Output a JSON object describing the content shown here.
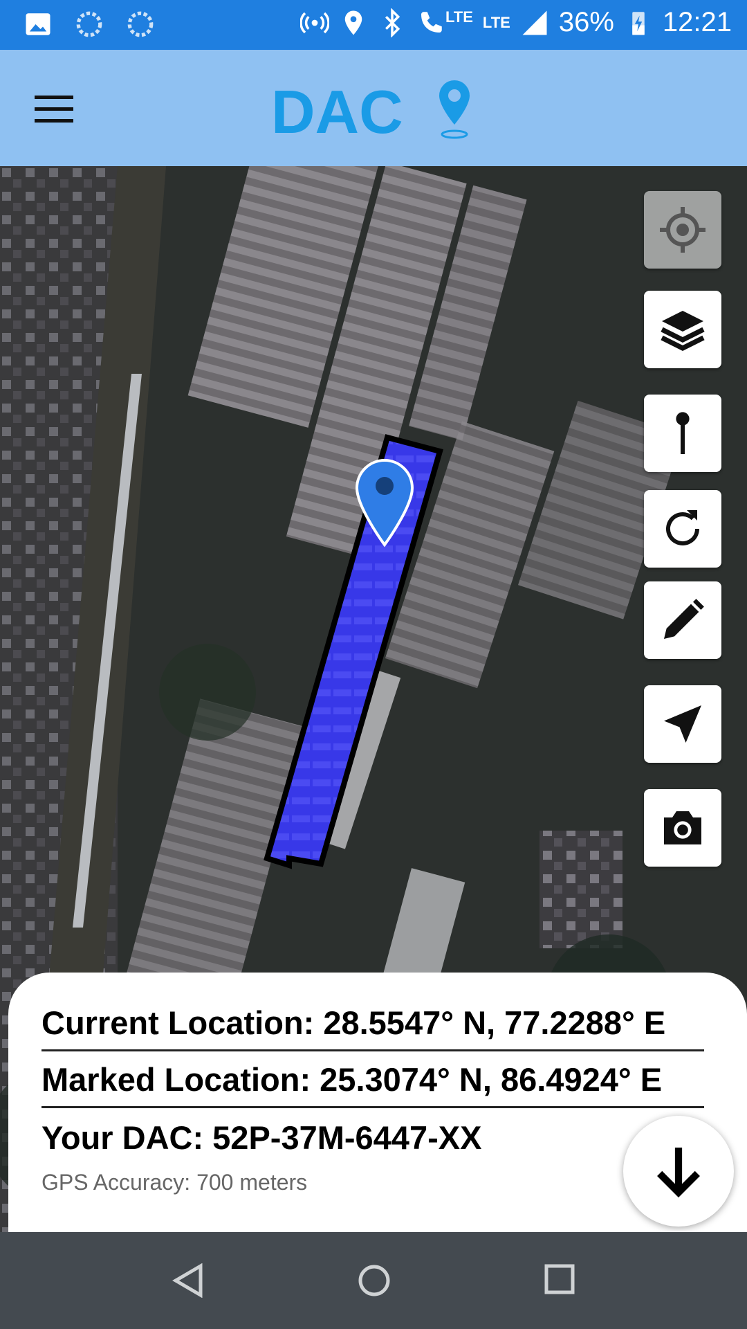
{
  "status_bar": {
    "battery": "36%",
    "time": "12:21",
    "network_1": "LTE",
    "network_2": "LTE",
    "icons": [
      "image-icon",
      "loading-icon",
      "loading-icon",
      "hotspot-icon",
      "location-icon",
      "bluetooth-icon",
      "call-lte-icon",
      "signal-icon",
      "battery-charging-icon"
    ]
  },
  "app_bar": {
    "menu_icon": "hamburger-menu-icon",
    "logo_text": "DAC",
    "logo_color": "#1a9be6"
  },
  "map": {
    "marker_color": "#2f7de6",
    "polygon_fill": "#3a3aee",
    "controls": [
      {
        "name": "my-location-button",
        "icon": "crosshair-icon"
      },
      {
        "name": "layers-button",
        "icon": "layers-icon"
      },
      {
        "name": "pin-button",
        "icon": "pin-icon"
      },
      {
        "name": "refresh-button",
        "icon": "refresh-icon"
      },
      {
        "name": "edit-button",
        "icon": "pencil-icon"
      },
      {
        "name": "navigate-button",
        "icon": "navigation-arrow-icon"
      },
      {
        "name": "camera-button",
        "icon": "camera-icon"
      }
    ]
  },
  "info": {
    "current_location": "Current Location: 28.5547° N, 77.2288° E",
    "marked_location": "Marked Location: 25.3074° N, 86.4924° E",
    "your_dac": "Your DAC: 52P-37M-6447-XX",
    "gps_accuracy": "GPS Accuracy: 700 meters",
    "collapse_icon": "arrow-down-icon"
  },
  "nav_bar": {
    "icons": [
      "back-icon",
      "home-icon",
      "recents-icon"
    ]
  }
}
